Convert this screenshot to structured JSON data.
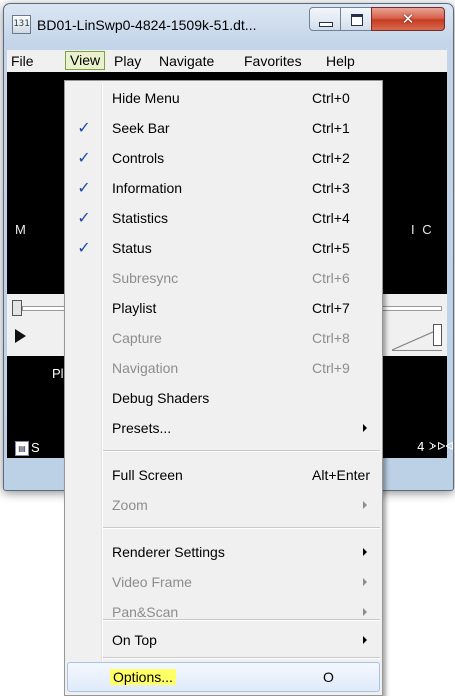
{
  "window": {
    "title": "BD01-LinSwp0-4824-1509k-51.dt...",
    "app_icon_text": "131",
    "close_glyph": "✕"
  },
  "menubar": {
    "items": [
      {
        "label": "File",
        "active": false
      },
      {
        "label": "View",
        "active": true
      },
      {
        "label": "Play",
        "active": false
      },
      {
        "label": "Navigate",
        "active": false
      },
      {
        "label": "Favorites",
        "active": false
      },
      {
        "label": "Help",
        "active": false
      }
    ]
  },
  "background": {
    "video_left_text": "M",
    "video_right_text": "I C",
    "info_text": "Pl",
    "status_text": "S",
    "status_right_text": "4",
    "status_right_icon": "ᗆᐅᐊ"
  },
  "view_menu": {
    "check_glyph": "✓",
    "items": [
      {
        "label": "Hide Menu",
        "shortcut": "Ctrl+0",
        "checked": false,
        "disabled": false
      },
      {
        "label": "Seek Bar",
        "shortcut": "Ctrl+1",
        "checked": true,
        "disabled": false
      },
      {
        "label": "Controls",
        "shortcut": "Ctrl+2",
        "checked": true,
        "disabled": false
      },
      {
        "label": "Information",
        "shortcut": "Ctrl+3",
        "checked": true,
        "disabled": false
      },
      {
        "label": "Statistics",
        "shortcut": "Ctrl+4",
        "checked": true,
        "disabled": false
      },
      {
        "label": "Status",
        "shortcut": "Ctrl+5",
        "checked": true,
        "disabled": false
      },
      {
        "label": "Subresync",
        "shortcut": "Ctrl+6",
        "checked": false,
        "disabled": true
      },
      {
        "label": "Playlist",
        "shortcut": "Ctrl+7",
        "checked": false,
        "disabled": false
      },
      {
        "label": "Capture",
        "shortcut": "Ctrl+8",
        "checked": false,
        "disabled": true
      },
      {
        "label": "Navigation",
        "shortcut": "Ctrl+9",
        "checked": false,
        "disabled": true
      },
      {
        "label": "Debug Shaders",
        "shortcut": "",
        "checked": false,
        "disabled": false
      },
      {
        "label": "Presets...",
        "shortcut": "",
        "submenu": true,
        "disabled": false
      },
      {
        "label": "Full Screen",
        "shortcut": "Alt+Enter",
        "disabled": false
      },
      {
        "label": "Zoom",
        "shortcut": "",
        "submenu": true,
        "disabled": true
      },
      {
        "label": "Renderer Settings",
        "shortcut": "",
        "submenu": true,
        "disabled": false
      },
      {
        "label": "Video Frame",
        "shortcut": "",
        "submenu": true,
        "disabled": true
      },
      {
        "label": "Pan&Scan",
        "shortcut": "",
        "submenu": true,
        "disabled": true
      },
      {
        "label": "On Top",
        "shortcut": "",
        "submenu": true,
        "disabled": false
      },
      {
        "label": "Options...",
        "shortcut": "O",
        "highlighted": true,
        "disabled": false
      }
    ]
  },
  "colors": {
    "check": "#1e4aa8",
    "highlight": "#ffff66",
    "disabled_text": "#8d8d8d"
  }
}
